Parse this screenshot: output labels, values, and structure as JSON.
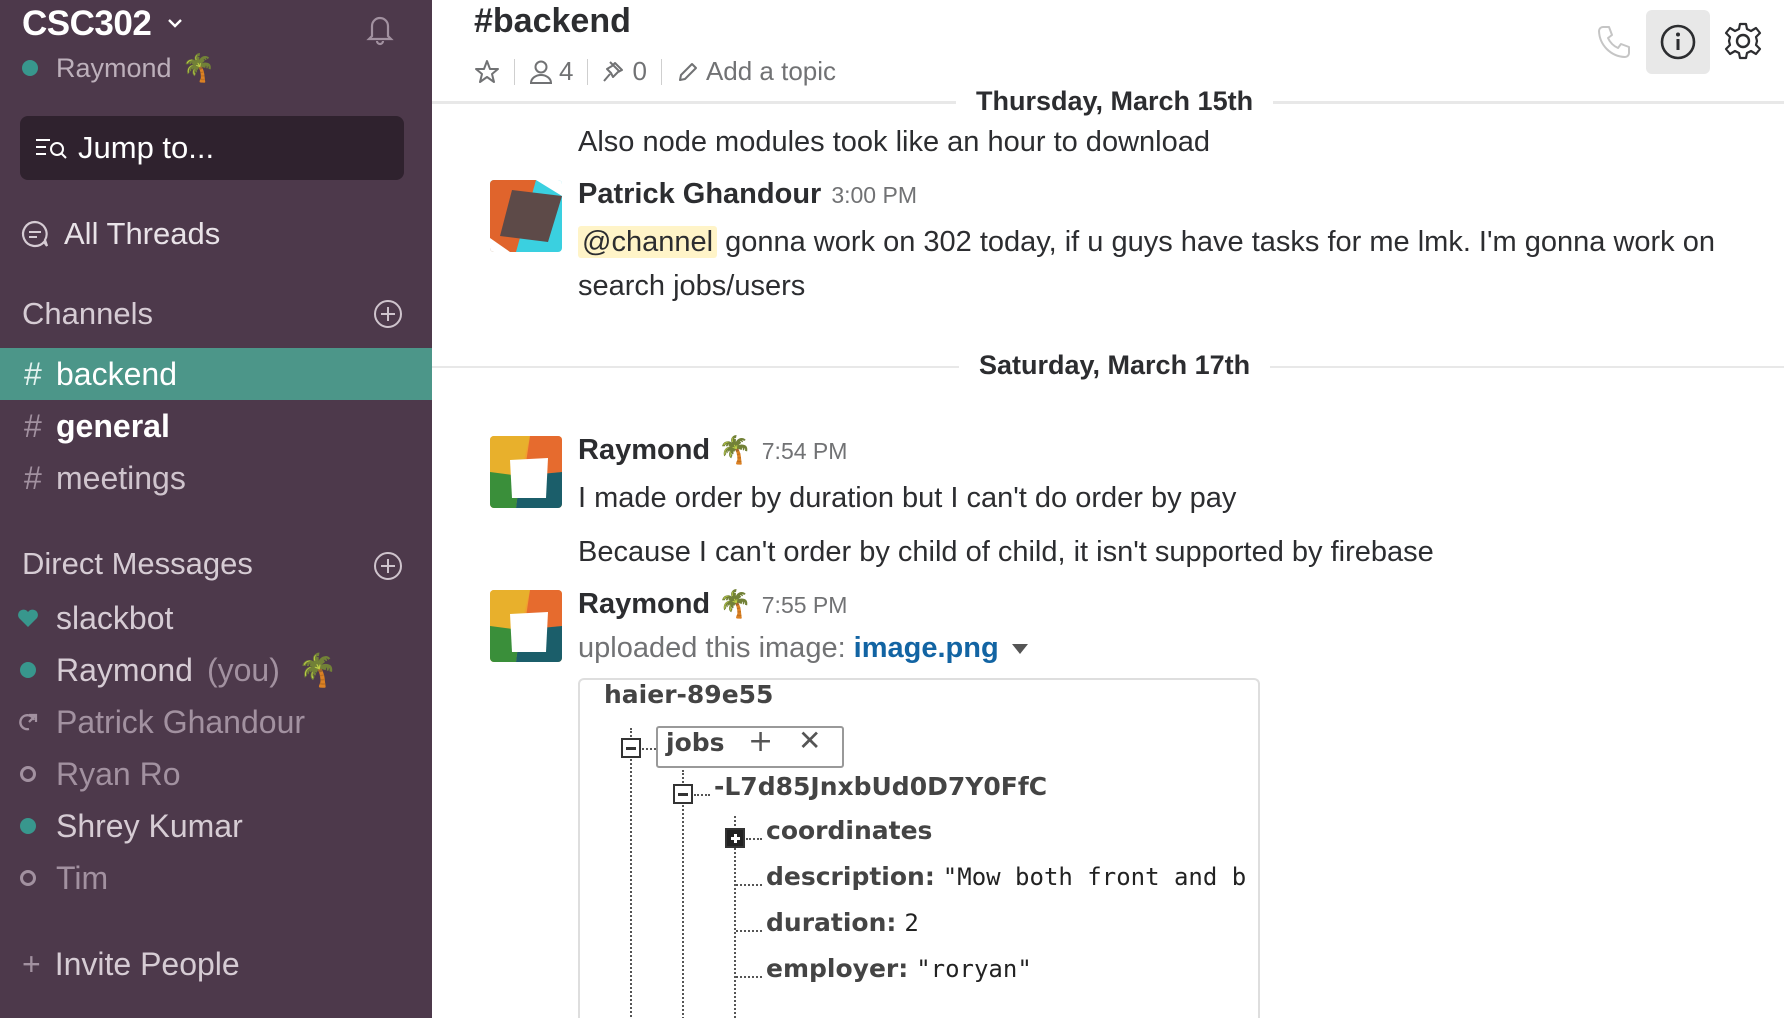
{
  "sidebar": {
    "team_name": "CSC302",
    "user_name": "Raymond",
    "user_status_emoji": "🌴",
    "jump_to": "Jump to...",
    "all_threads": "All Threads",
    "channels_header": "Channels",
    "channels": [
      {
        "name": "backend",
        "state": "active"
      },
      {
        "name": "general",
        "state": "unread"
      },
      {
        "name": "meetings",
        "state": "read"
      }
    ],
    "dm_header": "Direct Messages",
    "direct_messages": [
      {
        "name": "slackbot",
        "indicator": "heart"
      },
      {
        "name": "Raymond",
        "suffix": "(you)",
        "emoji": "🌴",
        "indicator": "online"
      },
      {
        "name": "Patrick Ghandour",
        "indicator": "away-link"
      },
      {
        "name": "Ryan Ro",
        "indicator": "offline"
      },
      {
        "name": "Shrey Kumar",
        "indicator": "online"
      },
      {
        "name": "Tim",
        "indicator": "offline"
      }
    ],
    "invite": "Invite People"
  },
  "header": {
    "channel_title": "#backend",
    "member_count": "4",
    "pinned_count": "0",
    "add_topic": "Add a topic"
  },
  "messages": {
    "day1": "Thursday, March 15th",
    "continued_text": "Also node modules took like an hour to download",
    "msg1": {
      "sender": "Patrick Ghandour",
      "time": "3:00 PM",
      "mention": "@channel",
      "text_line1": " gonna work on 302 today, if u guys have tasks for me lmk. I'm gonna work on",
      "text_line2": "search jobs/users"
    },
    "day2": "Saturday, March 17th",
    "msg2": {
      "sender": "Raymond",
      "emoji": "🌴",
      "time": "7:54 PM",
      "text_line1": "I made order by duration but I can't do order by pay",
      "text_line2": "Because I can't order by child of child, it isn't supported by firebase"
    },
    "msg3": {
      "sender": "Raymond",
      "emoji": "🌴",
      "time": "7:55 PM",
      "upload_prefix": "uploaded this image:",
      "upload_link": "image.png"
    }
  },
  "image_preview": {
    "root": "haier-89e55",
    "node_jobs": "jobs",
    "node_id": "-L7d85JnxbUd0D7Y0FfC",
    "node_coordinates": "coordinates",
    "fields": [
      {
        "key": "description:",
        "value": "\"Mow both front and b"
      },
      {
        "key": "duration:",
        "value": "2"
      },
      {
        "key": "employer:",
        "value": "\"roryan\""
      }
    ]
  },
  "colors": {
    "sidebar_bg": "#4d394b",
    "active_channel": "#4c9689",
    "presence_online": "#38978d",
    "link": "#1264a3",
    "mention_bg": "#fff4c8"
  }
}
